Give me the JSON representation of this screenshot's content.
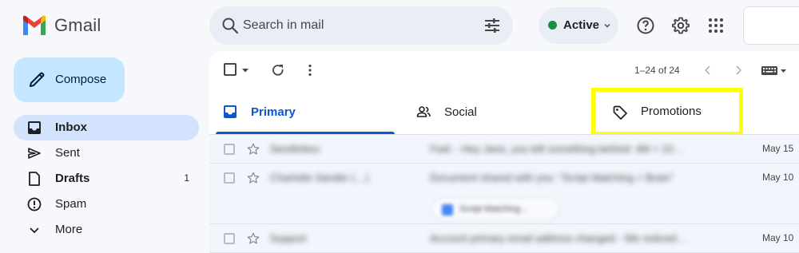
{
  "app": {
    "name": "Gmail"
  },
  "search": {
    "placeholder": "Search in mail"
  },
  "status": {
    "label": "Active",
    "color": "#1e8e3e"
  },
  "sidebar": {
    "compose_label": "Compose",
    "items": [
      {
        "label": "Inbox",
        "icon": "inbox-icon",
        "selected": true,
        "bold": true,
        "count": ""
      },
      {
        "label": "Sent",
        "icon": "send-icon",
        "selected": false,
        "bold": false,
        "count": ""
      },
      {
        "label": "Drafts",
        "icon": "draft-icon",
        "selected": false,
        "bold": true,
        "count": "1"
      },
      {
        "label": "Spam",
        "icon": "report-icon",
        "selected": false,
        "bold": false,
        "count": ""
      },
      {
        "label": "More",
        "icon": "chevron-down-icon",
        "selected": false,
        "bold": false,
        "count": ""
      }
    ]
  },
  "toolbar": {
    "pagination": "1–24 of 24"
  },
  "tabs": [
    {
      "label": "Primary",
      "icon": "inbox-icon",
      "active": true
    },
    {
      "label": "Social",
      "icon": "people-icon",
      "active": false
    },
    {
      "label": "Promotions",
      "icon": "tag-icon",
      "active": false,
      "highlighted": true
    }
  ],
  "emails": [
    {
      "sender": "SendInbox",
      "subject": "Fwd: - Hey Jane, you left something behind: 4M + 10…",
      "date": "May 15",
      "attachment": ""
    },
    {
      "sender": "Charlotte Sander (…)",
      "subject": "Document shared with you: \"Script Matching + Brain\"",
      "date": "May 10",
      "attachment": "Script Matching…"
    },
    {
      "sender": "Support",
      "subject": "Account primary email address changed - We noticed…",
      "date": "May 10",
      "attachment": ""
    }
  ],
  "colors": {
    "accent": "#0b57d0",
    "compose_bg": "#c2e7ff",
    "selected_nav": "#d3e3fd",
    "highlight": "#ffff00"
  }
}
